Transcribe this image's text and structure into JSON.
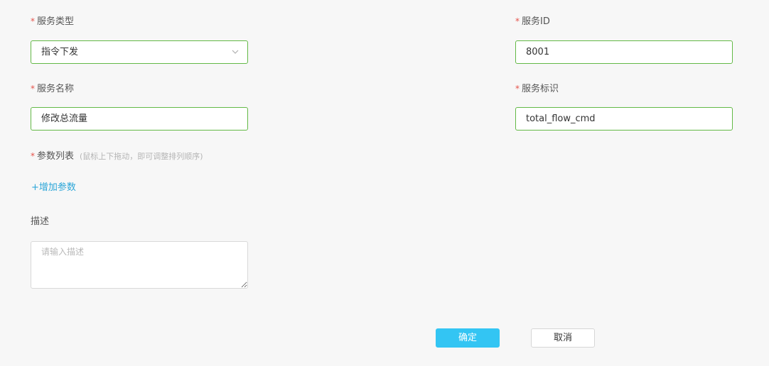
{
  "form": {
    "service_type": {
      "label": "服务类型",
      "value": "指令下发"
    },
    "service_id": {
      "label": "服务ID",
      "value": "8001"
    },
    "service_name": {
      "label": "服务名称",
      "value": "修改总流量"
    },
    "service_identifier": {
      "label": "服务标识",
      "value": "total_flow_cmd"
    },
    "param_list": {
      "label": "参数列表",
      "hint": "(鼠标上下拖动，即可调整排列顺序)",
      "add_label": "+增加参数"
    },
    "description": {
      "label": "描述",
      "placeholder": "请输入描述"
    },
    "required_mark": "*"
  },
  "actions": {
    "confirm_label": "确定",
    "cancel_label": "取消"
  },
  "colors": {
    "required": "#e5534b",
    "valid_border": "#63b946",
    "link": "#2ca6d8",
    "primary_button": "#33c5f3"
  },
  "icons": {
    "select_arrow": "chevron-down-icon"
  }
}
